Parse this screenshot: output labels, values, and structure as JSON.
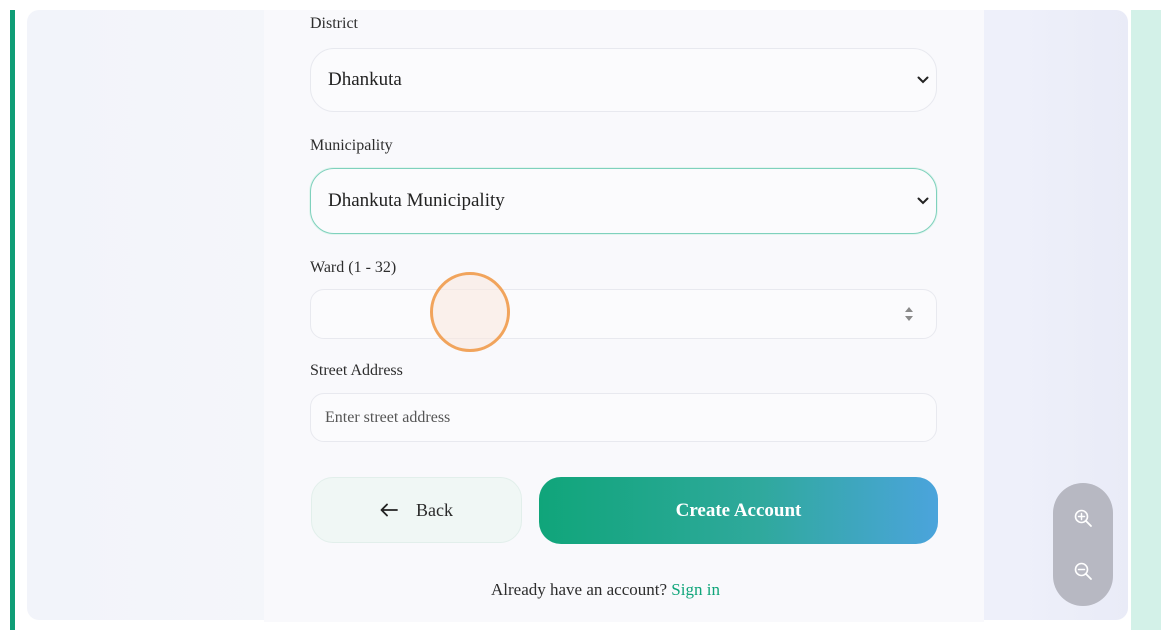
{
  "form": {
    "district_label": "District",
    "district_value": "Dhankuta",
    "municipality_label": "Municipality",
    "municipality_value": "Dhankuta Municipality",
    "ward_label": "Ward (1 - 32)",
    "ward_value": "",
    "street_label": "Street Address",
    "street_placeholder": "Enter street address"
  },
  "actions": {
    "back_label": "Back",
    "create_label": "Create Account"
  },
  "footer": {
    "prompt_text": "Already have an account?",
    "signin_label": "Sign in"
  },
  "icons": {
    "back": "arrow-left-icon",
    "dropdown": "chevron-down-icon",
    "spinner": "number-spinner-icon",
    "zoom_in": "zoom-in-icon",
    "zoom_out": "zoom-out-icon"
  },
  "colors": {
    "accent": "#10a57a",
    "gradient_end": "#4ba4dc",
    "focus_border": "#7fd1bd",
    "cursor_ring": "#f1a45c"
  }
}
